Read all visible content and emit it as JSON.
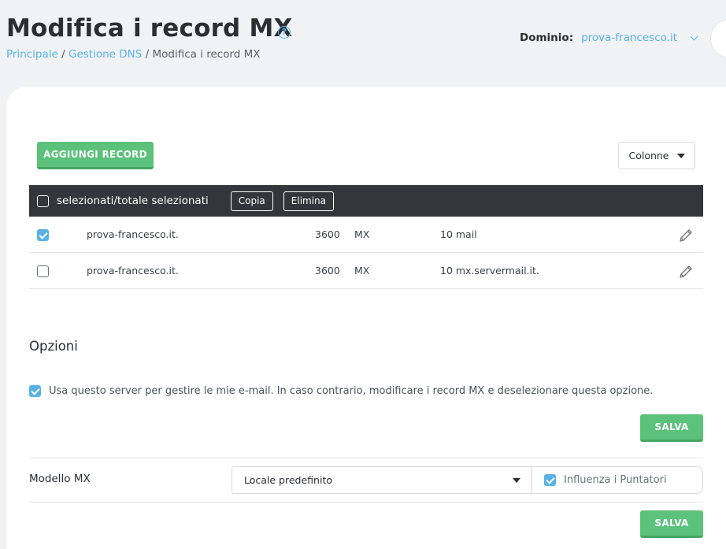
{
  "header": {
    "title": "Modifica i record MX",
    "help_icon": "question-circle-icon",
    "breadcrumb": {
      "items": [
        "Principale",
        "Gestione DNS",
        "Modifica i record MX"
      ],
      "separator": "/"
    },
    "domain_label": "Dominio:",
    "domain_value": "prova-francesco.it"
  },
  "toolbar": {
    "add_label": "AGGIUNGI RECORD",
    "columns_label": "Colonne"
  },
  "table": {
    "header_label": "selezionati/totale selezionati",
    "copy_label": "Copia",
    "delete_label": "Elimina",
    "rows": [
      {
        "checked": true,
        "name": "prova-francesco.it.",
        "ttl": "3600",
        "type": "MX",
        "value": "10 mail"
      },
      {
        "checked": false,
        "name": "prova-francesco.it.",
        "ttl": "3600",
        "type": "MX",
        "value": "10 mx.servermail.it."
      }
    ]
  },
  "options": {
    "title": "Opzioni",
    "use_server_text": "Usa questo server per gestire le mie e-mail. In caso contrario, modificare i record MX e deselezionare questa opzione.",
    "use_server_checked": true,
    "save_label": "SALVA"
  },
  "mx_model": {
    "label": "Modello MX",
    "selected": "Locale predefinito",
    "influence_label": "Influenza i Puntatori",
    "influence_checked": true,
    "save_label": "SALVA"
  },
  "colors": {
    "accent": "#56b5e6",
    "green": "#5cc17b",
    "table_head": "#34363b",
    "background": "#f1f2f6"
  }
}
